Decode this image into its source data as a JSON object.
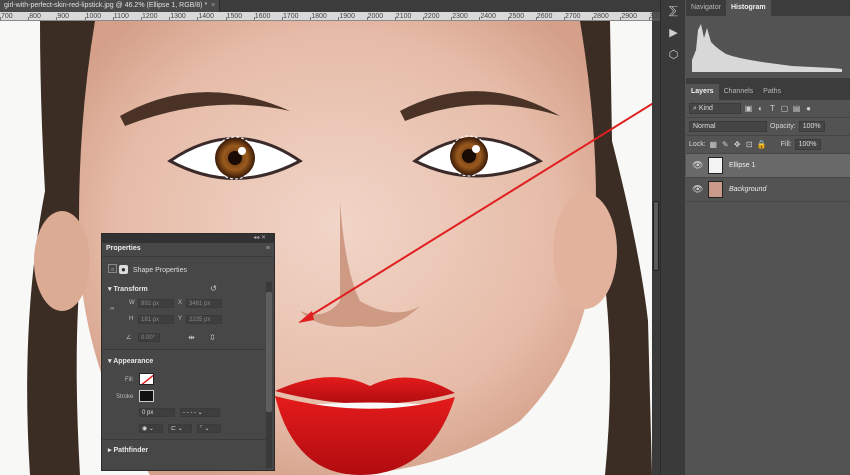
{
  "document": {
    "tab_title": "girl-with-perfect-skin-red-lipstick.jpg @ 46.2% (Ellipse 1, RGB/8) *",
    "close": "×"
  },
  "ruler": {
    "ticks": [
      "700",
      "800",
      "900",
      "1000",
      "1100",
      "1200",
      "1300",
      "1400",
      "1500",
      "1600",
      "1700",
      "1800",
      "1900",
      "2000",
      "2100",
      "2200",
      "2300",
      "2400",
      "2500",
      "2600",
      "2700",
      "2800",
      "2900",
      "3000",
      "3100",
      "3200",
      "3300"
    ]
  },
  "tools": [
    {
      "icon": "history-brush-icon",
      "glyph": "⅀"
    },
    {
      "icon": "play-icon",
      "glyph": "▶"
    },
    {
      "icon": "cube-icon",
      "glyph": "⬡"
    }
  ],
  "top_panel": {
    "tabs": [
      "Navigator",
      "Histogram"
    ],
    "active": "Histogram"
  },
  "layers_panel": {
    "tabs": [
      "Layers",
      "Channels",
      "Paths"
    ],
    "active": "Layers",
    "filter_label": "Kind",
    "blend_mode": "Normal",
    "opacity_label": "Opacity:",
    "opacity_value": "100%",
    "lock_label": "Lock:",
    "fill_label": "Fill:",
    "fill_value": "100%",
    "layers": [
      {
        "name": "Ellipse 1",
        "selected": true
      },
      {
        "name": "Background",
        "selected": false
      }
    ]
  },
  "properties": {
    "title": "Properties",
    "shape_label": "Shape Properties",
    "transform_label": "Transform",
    "w_label": "W",
    "w_value": "992 px",
    "x_label": "X",
    "x_value": "3461 px",
    "h_label": "H",
    "h_value": "181 px",
    "y_label": "Y",
    "y_value": "2235 px",
    "angle_value": "0.00°",
    "appearance_label": "Appearance",
    "fill_label": "Fill",
    "stroke_label": "Stroke",
    "stroke_width": "0 px",
    "pathfinder_label": "Pathfinder"
  },
  "colors": {
    "accent_red": "#e02020",
    "panel_bg": "#535353"
  }
}
